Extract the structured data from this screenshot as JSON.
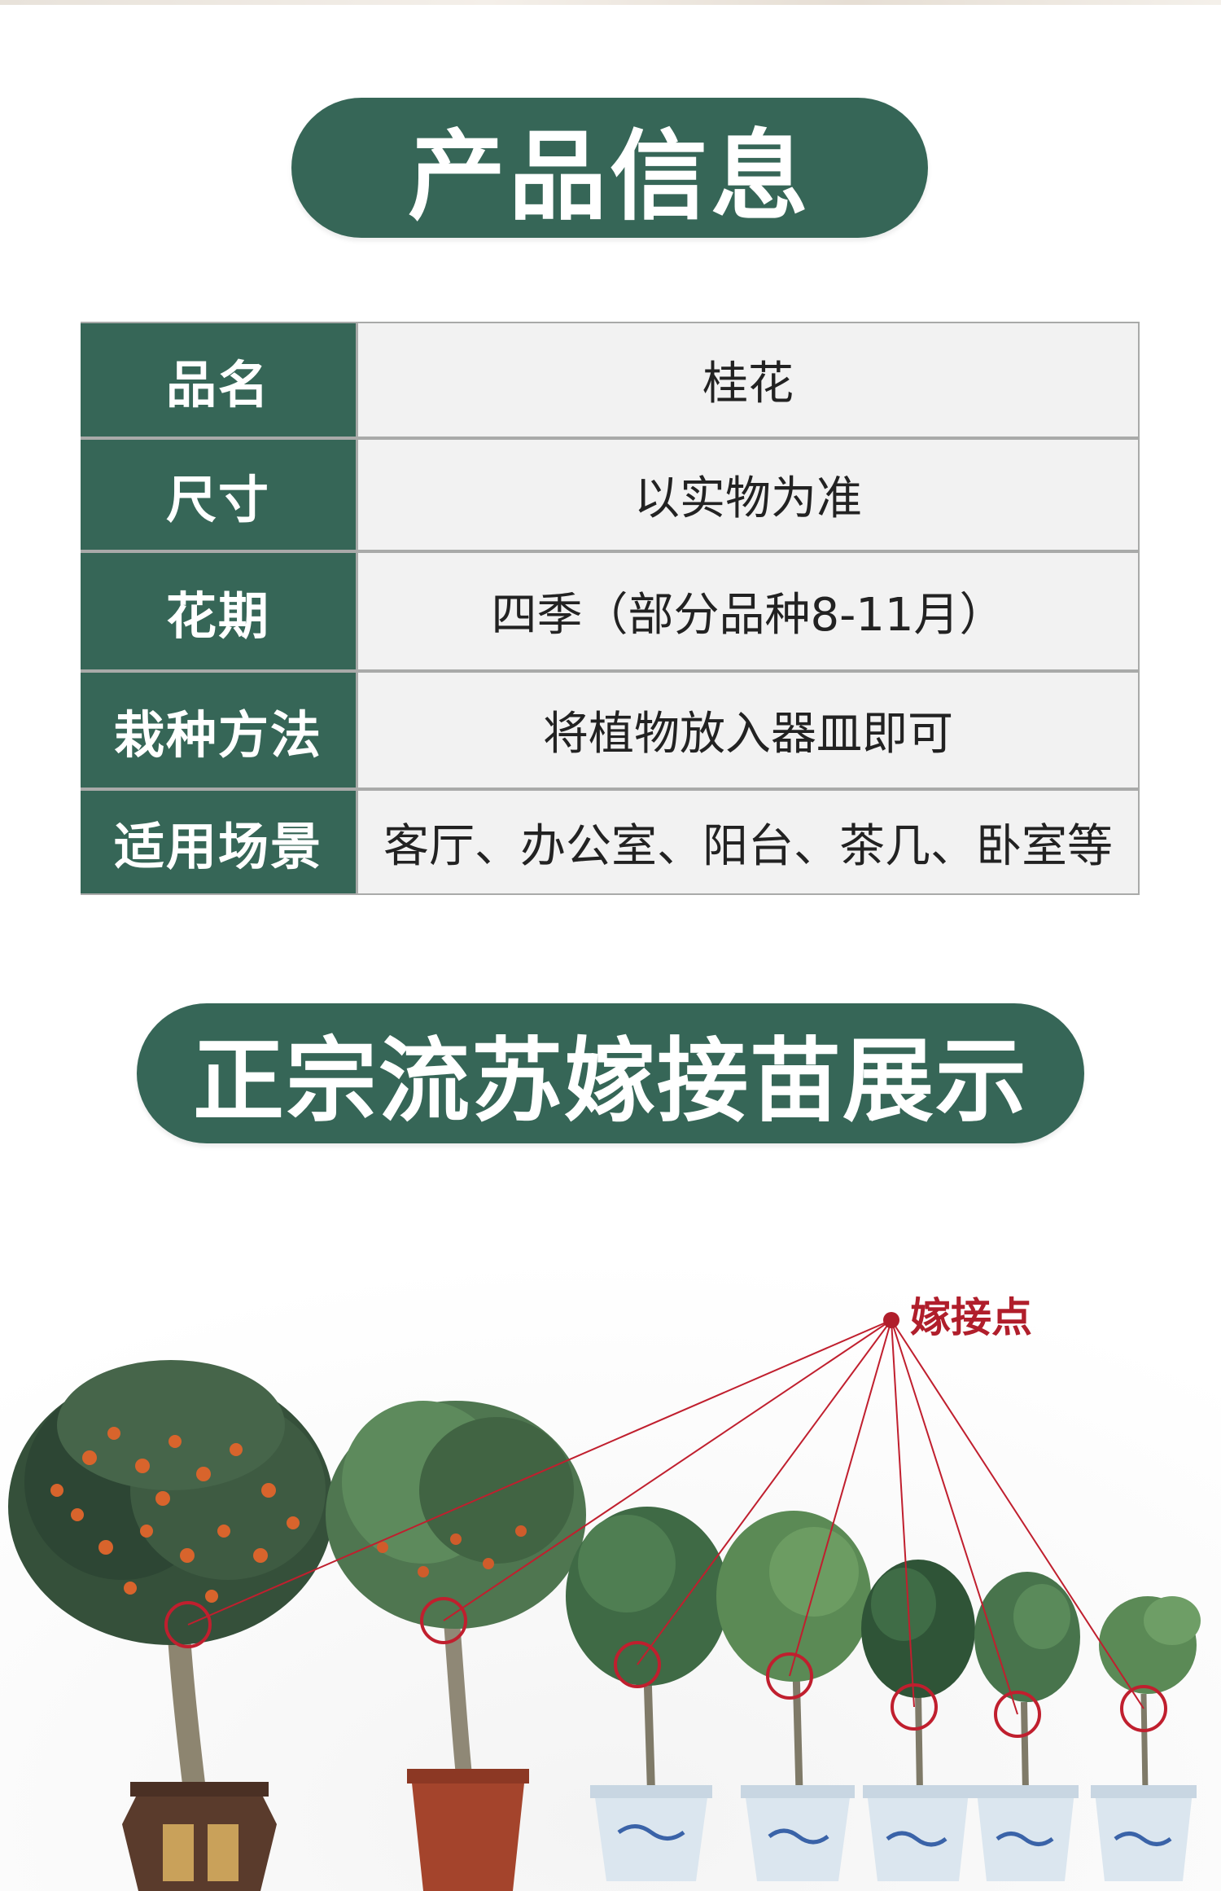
{
  "header_title": "产品信息",
  "specs": [
    {
      "label": "品名",
      "value": "桂花"
    },
    {
      "label": "尺寸",
      "value": "以实物为准"
    },
    {
      "label": "花期",
      "value": "四季（部分品种8-11月）"
    },
    {
      "label": "栽种方法",
      "value": "将植物放入器皿即可"
    },
    {
      "label": "适用场景",
      "value": "客厅、办公室、阳台、茶几、卧室等"
    }
  ],
  "showcase_title": "正宗流苏嫁接苗展示",
  "graft_point_label": "嫁接点",
  "colors": {
    "brand_green": "#366657",
    "cell_background": "#f2f2f2",
    "graft_red": "#b01e2b"
  }
}
